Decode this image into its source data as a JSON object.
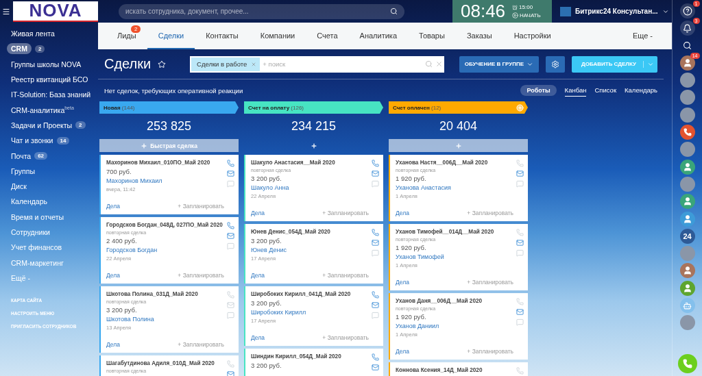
{
  "logo": {
    "text": "NOVA"
  },
  "search": {
    "placeholder": "искать сотрудника, документ, прочее..."
  },
  "clock": {
    "time": "08:46",
    "alarm": "15:00",
    "start": "НАЧАТЬ"
  },
  "user": {
    "name": "Битрикс24 Консультан..."
  },
  "sidebar": {
    "items": [
      {
        "label": "Живая лента",
        "selected": false
      },
      {
        "label": "CRM",
        "selected": true,
        "badge": "2"
      },
      {
        "label": "Группы школы NOVA",
        "selected": false
      },
      {
        "label": "Реестр квитанций БСО",
        "selected": false
      },
      {
        "label": "IT-Solution: База знаний",
        "selected": false
      },
      {
        "label": "CRM-аналитика$^{beta}$",
        "selected": false
      },
      {
        "label": "Задачи и Проекты",
        "selected": false,
        "badge": "2"
      },
      {
        "label": "Чат и звонки",
        "selected": false,
        "badge": "14"
      },
      {
        "label": "Почта",
        "selected": false,
        "badge": "62"
      },
      {
        "label": "Группы",
        "selected": false
      },
      {
        "label": "Диск",
        "selected": false
      },
      {
        "label": "Календарь",
        "selected": false
      },
      {
        "label": "Время и отчеты",
        "selected": false
      },
      {
        "label": "Сотрудники",
        "selected": false
      },
      {
        "label": "Учет финансов",
        "selected": false
      },
      {
        "label": "CRM-маркетинг",
        "selected": false
      },
      {
        "label": "Ещё -",
        "selected": false
      }
    ],
    "links": [
      "КАРТА САЙТА",
      "НАСТРОИТЬ МЕНЮ",
      "ПРИГЛАСИТЬ СОТРУДНИКОВ"
    ]
  },
  "tabs": [
    {
      "label": "Лиды",
      "selected": false,
      "badge": "2"
    },
    {
      "label": "Сделки",
      "selected": true
    },
    {
      "label": "Контакты",
      "selected": false
    },
    {
      "label": "Компании",
      "selected": false
    },
    {
      "label": "Счета",
      "selected": false
    },
    {
      "label": "Аналитика",
      "selected": false
    },
    {
      "label": "Товары",
      "selected": false
    },
    {
      "label": "Заказы",
      "selected": false
    },
    {
      "label": "Настройки",
      "selected": false
    },
    {
      "label": "Еще -",
      "selected": false
    }
  ],
  "toolbar": {
    "title": "Сделки",
    "filter_chip": "Сделки в работе",
    "filter_placeholder": "+ поиск",
    "category_button": "ОБУЧЕНИЕ В ГРУППЕ",
    "add_button": "ДОБАВИТЬ СДЕЛКУ"
  },
  "info": {
    "message": "Нет сделок, требующих оперативной реакции",
    "robots_button": "Роботы",
    "views": [
      {
        "label": "Канбан",
        "selected": true
      },
      {
        "label": "Список",
        "selected": false
      },
      {
        "label": "Календарь",
        "selected": false
      }
    ]
  },
  "columns": [
    {
      "name": "Новая",
      "count": "(144)",
      "color": "#39a8ef",
      "total": "253 825",
      "add_label": "Быстрая сделка",
      "cards": [
        {
          "title": "Махоринов Михаил_010ПО_Май 2020",
          "price": "700 руб.",
          "contact": "Махоринов Михаил",
          "date": "вчера, 11:42",
          "phone_active": true,
          "mail_active": true,
          "actions": "Дела",
          "plan": "+ Запланировать"
        },
        {
          "title": "Городсков Богдан_048Д, 027ПО_Май 2020",
          "note": "повторная сделка",
          "price": "2 400 руб.",
          "contact": "Городсков Богдан",
          "date": "22 Апреля",
          "phone_active": true,
          "mail_active": true,
          "actions": "Дела",
          "plan": "+ Запланировать"
        },
        {
          "title": "Шкотова Полина_031Д_Май 2020",
          "note": "повторная сделка",
          "price": "3 200 руб.",
          "contact": "Шкотова Полина",
          "date": "13 Апреля",
          "phone_active": false,
          "mail_active": false,
          "actions": "Дела",
          "plan": "+ Запланировать"
        },
        {
          "title": "Шагабутдинова Адиля_010Д_Май 2020",
          "note": "повторная сделка",
          "phone_active": false,
          "mail_active": true
        }
      ]
    },
    {
      "name": "Счет на оплату",
      "count": "(126)",
      "color": "#47e4c2",
      "total": "234 215",
      "cards": [
        {
          "title": "Шакуло Анастасия__Май 2020",
          "note": "повторная сделка",
          "price": "3 200 руб.",
          "contact": "Шакуло Анна",
          "date": "22 Апреля",
          "phone_active": true,
          "mail_active": true,
          "actions": "Дела",
          "plan": "+ Запланировать"
        },
        {
          "title": "Юнев Денис_054Д_Май 2020",
          "price": "3 200 руб.",
          "contact": "Юнев Денис",
          "date": "17 Апреля",
          "phone_active": true,
          "mail_active": true,
          "actions": "Дела",
          "plan": "+ Запланировать"
        },
        {
          "title": "Широбоких Кирилл_041Д_Май 2020",
          "price": "3 200 руб.",
          "contact": "Широбоких Кирилл",
          "date": "17 Апреля",
          "phone_active": true,
          "mail_active": true,
          "actions": "Дела",
          "plan": "+ Запланировать"
        },
        {
          "title": "Шиндин Кирилл_054Д_Май 2020",
          "price": "3 200 руб.",
          "phone_active": true,
          "mail_active": true
        }
      ]
    },
    {
      "name": "Счет оплачен",
      "count": "(12)",
      "color": "#ffa900",
      "total": "20 404",
      "cards": [
        {
          "title": "Уханова Настя__006Д__Май 2020",
          "note": "повторная сделка",
          "price": "1 920 руб.",
          "contact": "Уханова Анастасия",
          "date": "1 Апреля",
          "phone_active": false,
          "mail_active": true,
          "actions": "Дела",
          "plan": "+ Запланировать"
        },
        {
          "title": "Уханов Тимофей__014Д__Май 2020",
          "note": "повторная сделка",
          "price": "1 920 руб.",
          "contact": "Уханов Тимофей",
          "date": "1 Апреля",
          "phone_active": false,
          "mail_active": true,
          "actions": "Дела",
          "plan": "+ Запланировать"
        },
        {
          "title": "Уханов Даня__006Д__Май 2020",
          "note": "повторная сделка",
          "price": "1 920 руб.",
          "contact": "Уханов Даниил",
          "date": "1 Апреля",
          "phone_active": false,
          "mail_active": true,
          "actions": "Дела",
          "plan": "+ Запланировать"
        },
        {
          "title": "Коннова Ксения_14Д_Май 2020",
          "phone_active": false
        }
      ]
    }
  ],
  "rightbar": [
    {
      "kind": "help",
      "badge": "1"
    },
    {
      "kind": "bell",
      "badge": "3"
    },
    {
      "kind": "search"
    },
    {
      "kind": "person",
      "color": "#a9745c",
      "badge": "14"
    },
    {
      "kind": "photo"
    },
    {
      "kind": "photo"
    },
    {
      "kind": "photo"
    },
    {
      "kind": "phone",
      "color": "#e3532f"
    },
    {
      "kind": "photo"
    },
    {
      "kind": "person",
      "color": "#3aa57a"
    },
    {
      "kind": "photo"
    },
    {
      "kind": "person",
      "color": "#3aa57a"
    },
    {
      "kind": "person",
      "color": "#3d9bd8"
    },
    {
      "kind": "label",
      "color": "#2e5a96",
      "text": "24"
    },
    {
      "kind": "photo"
    },
    {
      "kind": "person",
      "color": "#a9745c"
    },
    {
      "kind": "person",
      "color": "#5ea52e"
    },
    {
      "kind": "bot",
      "color": "#84c0ec"
    },
    {
      "kind": "photo"
    },
    {
      "kind": "call",
      "color": "#6ccf1e"
    }
  ]
}
